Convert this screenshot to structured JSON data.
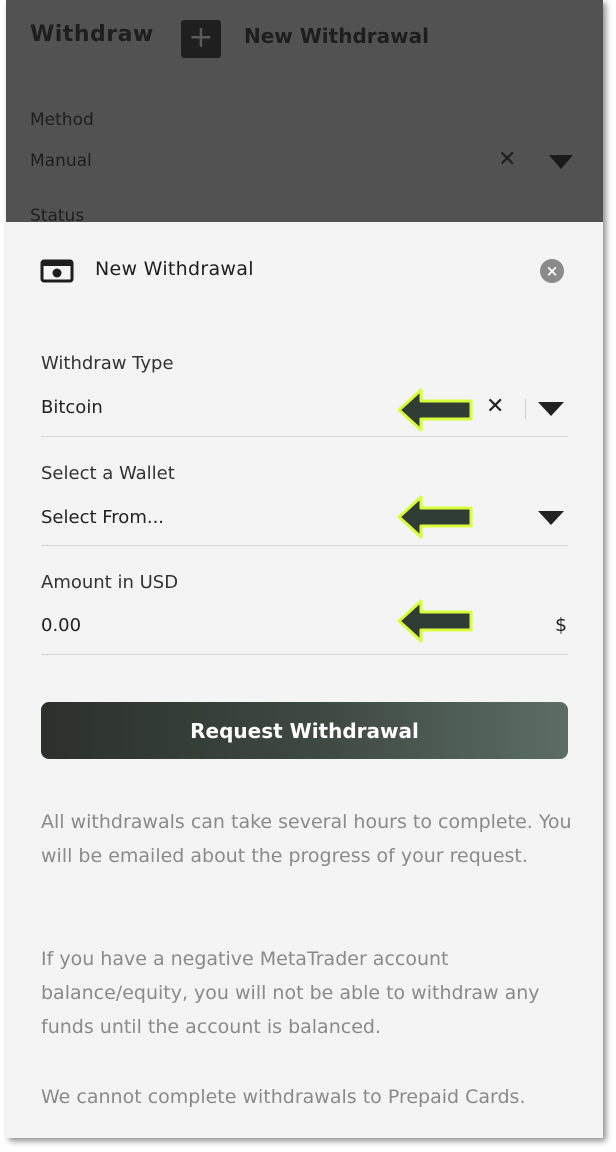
{
  "background": {
    "title": "Withdraw",
    "plus_label": "+",
    "new_label": "New Withdrawal",
    "method_label": "Method",
    "method_value": "Manual",
    "status_label": "Status"
  },
  "modal": {
    "title": "New Withdrawal",
    "close_label": "×",
    "fields": [
      {
        "label": "Withdraw Type",
        "value": "Bitcoin"
      },
      {
        "label": "Select a Wallet",
        "value": "Select From..."
      },
      {
        "label": "Amount in USD",
        "value": "0.00",
        "suffix": "$"
      }
    ],
    "clear_label": "×",
    "submit_label": "Request Withdrawal",
    "notes": [
      "All withdrawals can take several hours to complete. You will be emailed about the progress of your request.",
      "If you have a negative MetaTrader account balance/equity, you will not be able to withdraw any funds until the account is balanced.",
      "We cannot complete withdrawals to Prepaid Cards."
    ]
  },
  "colors": {
    "overlay": "#525252",
    "panel": "#f4f4f4",
    "arrow_fill": "#2f3d34",
    "arrow_outline": "#d7ff3c",
    "button_start": "#2b302c",
    "button_end": "#5c6e64"
  },
  "icons": [
    "plus-icon",
    "cash-icon",
    "close-icon",
    "clear-icon",
    "chevron-down-icon",
    "arrow-left-icon"
  ]
}
